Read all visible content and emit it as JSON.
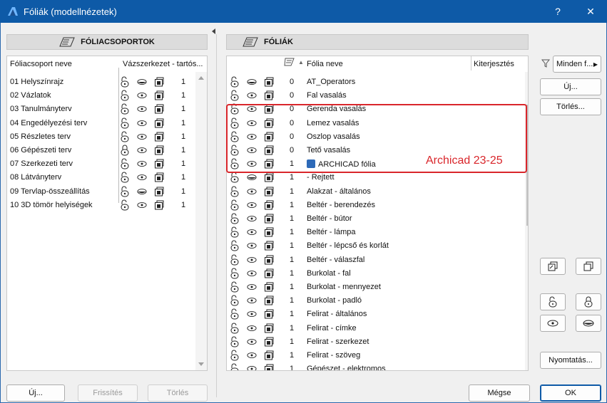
{
  "window": {
    "title": "Fóliák (modellnézetek)",
    "help_label": "?",
    "close_label": "✕"
  },
  "left": {
    "header": "FÓLIACSOPORTOK",
    "col_name": "Fóliacsoport neve",
    "col_props": "Vázszerkezet - tartós...",
    "rows": [
      {
        "name": "01 Helyszínrajz",
        "lock": "unlocked",
        "vis": "hidden",
        "num": "1"
      },
      {
        "name": "02 Vázlatok",
        "lock": "unlocked",
        "vis": "visible",
        "num": "1"
      },
      {
        "name": "03 Tanulmányterv",
        "lock": "unlocked",
        "vis": "visible",
        "num": "1"
      },
      {
        "name": "04 Engedélyezési terv",
        "lock": "unlocked",
        "vis": "visible",
        "num": "1"
      },
      {
        "name": "05 Részletes terv",
        "lock": "unlocked",
        "vis": "visible",
        "num": "1"
      },
      {
        "name": "06 Gépészeti terv",
        "lock": "locked",
        "vis": "visible",
        "num": "1"
      },
      {
        "name": "07 Szerkezeti terv",
        "lock": "unlocked",
        "vis": "visible",
        "num": "1"
      },
      {
        "name": "08 Látványterv",
        "lock": "unlocked",
        "vis": "visible",
        "num": "1"
      },
      {
        "name": "09 Tervlap-összeállítás",
        "lock": "unlocked",
        "vis": "hidden",
        "num": "1"
      },
      {
        "name": "10 3D tömör helyiségek",
        "lock": "unlocked",
        "vis": "visible",
        "num": "1"
      }
    ],
    "buttons": {
      "new": "Új...",
      "refresh": "Frissítés",
      "delete": "Törlés"
    }
  },
  "right": {
    "header": "FÓLIÁK",
    "col_name": "Fólia neve",
    "col_ext": "Kiterjesztés",
    "rows": [
      {
        "name": "AT_Operators",
        "lock": "unlocked",
        "vis": "hidden",
        "num": "0"
      },
      {
        "name": "Fal vasalás",
        "lock": "unlocked",
        "vis": "visible",
        "num": "0"
      },
      {
        "name": "Gerenda vasalás",
        "lock": "unlocked",
        "vis": "visible",
        "num": "0"
      },
      {
        "name": "Lemez vasalás",
        "lock": "unlocked",
        "vis": "visible",
        "num": "0"
      },
      {
        "name": "Oszlop vasalás",
        "lock": "unlocked",
        "vis": "visible",
        "num": "0"
      },
      {
        "name": "Tető vasalás",
        "lock": "unlocked",
        "vis": "visible",
        "num": "0"
      },
      {
        "name": "ARCHICAD fólia",
        "lock": "unlocked",
        "vis": "visible",
        "num": "1",
        "icon": "archicad-logo-icon"
      },
      {
        "name": "- Rejtett",
        "lock": "unlocked",
        "vis": "hidden",
        "num": "1"
      },
      {
        "name": "Alakzat - általános",
        "lock": "unlocked",
        "vis": "visible",
        "num": "1"
      },
      {
        "name": "Beltér - berendezés",
        "lock": "unlocked",
        "vis": "visible",
        "num": "1"
      },
      {
        "name": "Beltér - bútor",
        "lock": "unlocked",
        "vis": "visible",
        "num": "1"
      },
      {
        "name": "Beltér - lámpa",
        "lock": "unlocked",
        "vis": "visible",
        "num": "1"
      },
      {
        "name": "Beltér - lépcső és korlát",
        "lock": "unlocked",
        "vis": "visible",
        "num": "1"
      },
      {
        "name": "Beltér - válaszfal",
        "lock": "unlocked",
        "vis": "visible",
        "num": "1"
      },
      {
        "name": "Burkolat - fal",
        "lock": "unlocked",
        "vis": "visible",
        "num": "1"
      },
      {
        "name": "Burkolat - mennyezet",
        "lock": "unlocked",
        "vis": "visible",
        "num": "1"
      },
      {
        "name": "Burkolat - padló",
        "lock": "unlocked",
        "vis": "visible",
        "num": "1"
      },
      {
        "name": "Felirat - általános",
        "lock": "unlocked",
        "vis": "visible",
        "num": "1"
      },
      {
        "name": "Felirat - címke",
        "lock": "unlocked",
        "vis": "visible",
        "num": "1"
      },
      {
        "name": "Felirat - szerkezet",
        "lock": "unlocked",
        "vis": "visible",
        "num": "1"
      },
      {
        "name": "Felirat - szöveg",
        "lock": "unlocked",
        "vis": "visible",
        "num": "1"
      },
      {
        "name": "Gépészet - elektromos",
        "lock": "unlocked",
        "vis": "visible",
        "num": "1"
      }
    ],
    "filter_label": "Minden f...",
    "buttons": {
      "new": "Új...",
      "delete": "Törlés...",
      "print": "Nyomtatás...",
      "cancel": "Mégse",
      "ok": "OK"
    }
  },
  "annotation": {
    "text": "Archicad 23-25",
    "color": "#d9262b"
  },
  "colors": {
    "titlebar": "#0e5aa7",
    "accent": "#2d6ab8"
  }
}
